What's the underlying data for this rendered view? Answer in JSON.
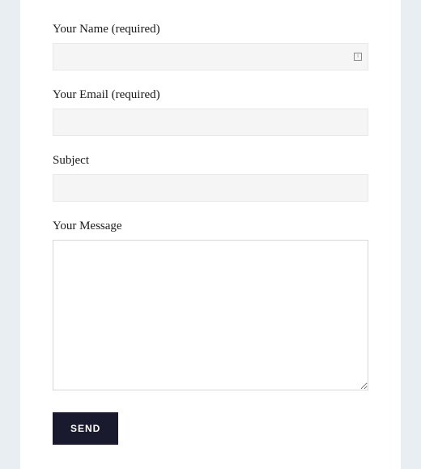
{
  "form": {
    "name": {
      "label": "Your Name (required)",
      "value": ""
    },
    "email": {
      "label": "Your Email (required)",
      "value": ""
    },
    "subject": {
      "label": "Subject",
      "value": ""
    },
    "message": {
      "label": "Your Message",
      "value": ""
    },
    "submit_label": "SEND"
  }
}
